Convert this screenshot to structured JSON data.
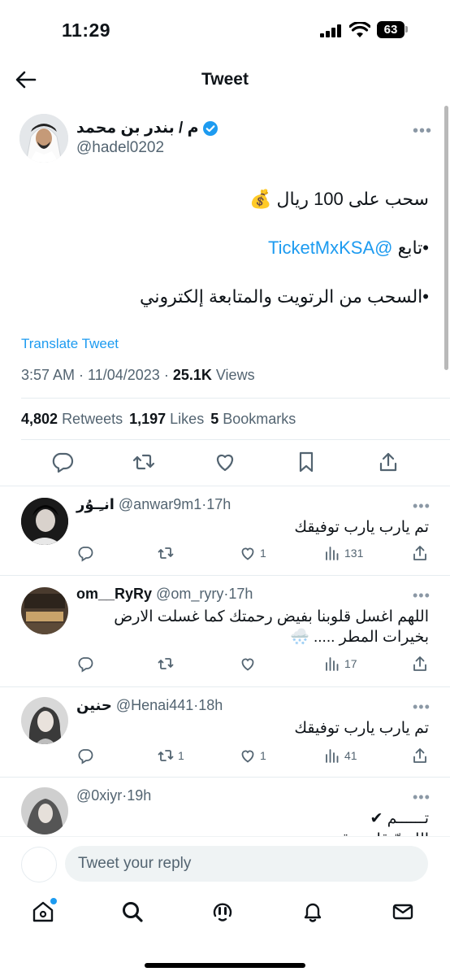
{
  "status_bar": {
    "time": "11:29",
    "battery": "63"
  },
  "header": {
    "title": "Tweet"
  },
  "tweet": {
    "display_name": "م / بندر بن محمد",
    "handle": "@hadel0202",
    "line1": "سحب على 100 ريال 💰",
    "line2_prefix": "•تابع ",
    "line2_mention": "@TicketMxKSA",
    "line3": "•السحب من الرتويت والمتابعة إلكتروني",
    "translate": "Translate Tweet",
    "time": "3:57 AM",
    "date": "11/04/2023",
    "views_count": "25.1K",
    "views_label": "Views",
    "retweets_count": "4,802",
    "retweets_label": "Retweets",
    "likes_count": "1,197",
    "likes_label": "Likes",
    "bookmarks_count": "5",
    "bookmarks_label": "Bookmarks"
  },
  "replies": [
    {
      "name": "انـِـوُر",
      "handle": "@anwar9m1",
      "age": "17h",
      "text": "تم يارب يارب توفيقك",
      "retweets": "",
      "likes": "1",
      "views": "131"
    },
    {
      "name": "om__RyRy",
      "handle": "@om_ryry",
      "age": "17h",
      "text": "اللهم اغسل قلوبنا بفيض رحمتك كما غسلت الارض بخيرات المطر ..... 🌨️",
      "retweets": "",
      "likes": "",
      "views": "17"
    },
    {
      "name": "حنين",
      "handle": "@Henai441",
      "age": "18h",
      "text": "تم يارب يارب توفيقك",
      "retweets": "1",
      "likes": "1",
      "views": "41"
    },
    {
      "name": "",
      "handle": "@0xiyr",
      "age": "19h",
      "text": "تــــــم ✔",
      "text2": "اللهـمّ قلب رقيق",
      "retweets": "",
      "likes": "",
      "views": ""
    }
  ],
  "composer": {
    "placeholder": "Tweet your reply"
  },
  "colors": {
    "accent": "#1d9bf0",
    "secondary_text": "#536471",
    "divider": "#e6ecf0"
  }
}
